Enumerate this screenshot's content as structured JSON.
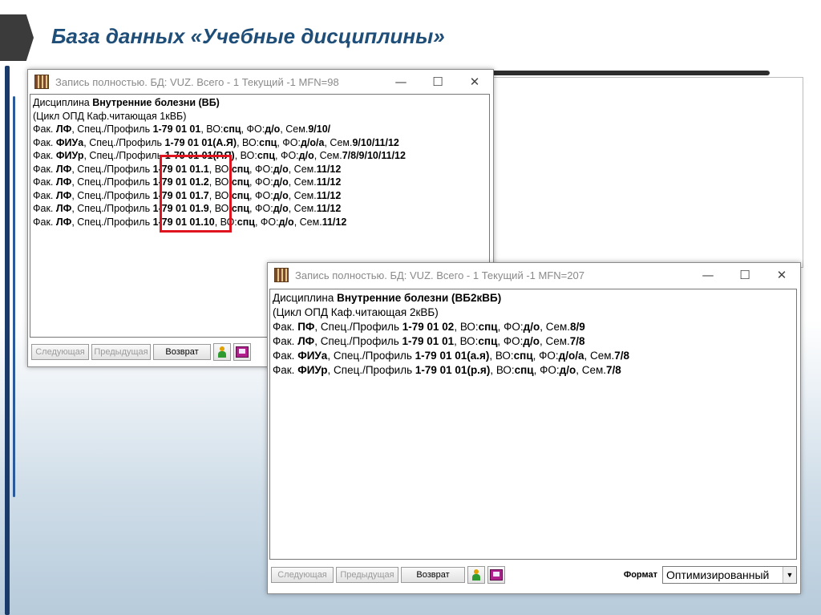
{
  "slide": {
    "title": "База данных «Учебные дисциплины»"
  },
  "window1": {
    "title": "Запись полностью.  БД: VUZ. Всего - 1  Текущий -1   MFN=98",
    "lines": [
      [
        [
          "Дисциплина ",
          false
        ],
        [
          "Внутренние болезни (ВБ)",
          true
        ]
      ],
      [
        [
          "(Цикл ОПД  Каф.читающая 1кВБ)",
          false
        ]
      ],
      [
        [
          " Фак. ",
          false
        ],
        [
          "ЛФ",
          true
        ],
        [
          ", Спец./Профиль ",
          false
        ],
        [
          "1-79 01 01",
          true
        ],
        [
          ", ВО:",
          false
        ],
        [
          "спц",
          true
        ],
        [
          ", ФО:",
          false
        ],
        [
          "д/о",
          true
        ],
        [
          ",  Сем.",
          false
        ],
        [
          "9/10/",
          true
        ]
      ],
      [
        [
          " Фак. ",
          false
        ],
        [
          "ФИУа",
          true
        ],
        [
          ", Спец./Профиль ",
          false
        ],
        [
          "1-79 01 01(А.Я)",
          true
        ],
        [
          ", ВО:",
          false
        ],
        [
          "спц",
          true
        ],
        [
          ", ФО:",
          false
        ],
        [
          "д/о/а",
          true
        ],
        [
          ",  Сем.",
          false
        ],
        [
          "9/10/11/12",
          true
        ]
      ],
      [
        [
          " Фак. ",
          false
        ],
        [
          "ФИУр",
          true
        ],
        [
          ", Спец./Профиль ",
          false
        ],
        [
          "1-79 01 01(Р.Я)",
          true
        ],
        [
          ", ВО:",
          false
        ],
        [
          "спц",
          true
        ],
        [
          ", ФО:",
          false
        ],
        [
          "д/о",
          true
        ],
        [
          ",  Сем.",
          false
        ],
        [
          "7/8/9/10/11/12",
          true
        ]
      ],
      [
        [
          " Фак. ",
          false
        ],
        [
          "ЛФ",
          true
        ],
        [
          ", Спец./Профиль ",
          false
        ],
        [
          "1-79 01 01.1",
          true
        ],
        [
          ", ВО:",
          false
        ],
        [
          "спц",
          true
        ],
        [
          ", ФО:",
          false
        ],
        [
          "д/о",
          true
        ],
        [
          ",  Сем.",
          false
        ],
        [
          "11/12",
          true
        ]
      ],
      [
        [
          " Фак. ",
          false
        ],
        [
          "ЛФ",
          true
        ],
        [
          ", Спец./Профиль ",
          false
        ],
        [
          "1-79 01 01.2",
          true
        ],
        [
          ", ВО:",
          false
        ],
        [
          "спц",
          true
        ],
        [
          ", ФО:",
          false
        ],
        [
          "д/о",
          true
        ],
        [
          ",  Сем.",
          false
        ],
        [
          "11/12",
          true
        ]
      ],
      [
        [
          " Фак. ",
          false
        ],
        [
          "ЛФ",
          true
        ],
        [
          ", Спец./Профиль ",
          false
        ],
        [
          "1-79 01 01.7",
          true
        ],
        [
          ", ВО:",
          false
        ],
        [
          "спц",
          true
        ],
        [
          ", ФО:",
          false
        ],
        [
          "д/о",
          true
        ],
        [
          ",  Сем.",
          false
        ],
        [
          "11/12",
          true
        ]
      ],
      [
        [
          " Фак. ",
          false
        ],
        [
          "ЛФ",
          true
        ],
        [
          ", Спец./Профиль ",
          false
        ],
        [
          "1-79 01 01.9",
          true
        ],
        [
          ", ВО:",
          false
        ],
        [
          "спц",
          true
        ],
        [
          ", ФО:",
          false
        ],
        [
          "д/о",
          true
        ],
        [
          ",  Сем.",
          false
        ],
        [
          "11/12",
          true
        ]
      ],
      [
        [
          " Фак. ",
          false
        ],
        [
          "ЛФ",
          true
        ],
        [
          ", Спец./Профиль ",
          false
        ],
        [
          "1-79 01 01.10",
          true
        ],
        [
          ", ВО:",
          false
        ],
        [
          "спц",
          true
        ],
        [
          ", ФО:",
          false
        ],
        [
          "д/о",
          true
        ],
        [
          ",  Сем.",
          false
        ],
        [
          "11/12",
          true
        ]
      ]
    ],
    "buttons": {
      "next": "Следующая",
      "prev": "Предыдущая",
      "back": "Возврат"
    },
    "icons": [
      "person-icon",
      "card-icon"
    ]
  },
  "window2": {
    "title": "Запись полностью.  БД: VUZ. Всего - 1  Текущий -1   MFN=207",
    "lines": [
      [
        [
          "Дисциплина ",
          false
        ],
        [
          "Внутренние болезни (ВБ2кВБ)",
          true
        ]
      ],
      [
        [
          "(Цикл ОПД  Каф.читающая 2кВБ)",
          false
        ]
      ],
      [
        [
          " Фак. ",
          false
        ],
        [
          "ПФ",
          true
        ],
        [
          ", Спец./Профиль ",
          false
        ],
        [
          "1-79 01 02",
          true
        ],
        [
          ", ВО:",
          false
        ],
        [
          "спц",
          true
        ],
        [
          ", ФО:",
          false
        ],
        [
          "д/о",
          true
        ],
        [
          ",  Сем.",
          false
        ],
        [
          "8/9",
          true
        ]
      ],
      [
        [
          " Фак. ",
          false
        ],
        [
          "ЛФ",
          true
        ],
        [
          ", Спец./Профиль ",
          false
        ],
        [
          "1-79 01 01",
          true
        ],
        [
          ", ВО:",
          false
        ],
        [
          "спц",
          true
        ],
        [
          ", ФО:",
          false
        ],
        [
          "д/о",
          true
        ],
        [
          ",  Сем.",
          false
        ],
        [
          "7/8",
          true
        ]
      ],
      [
        [
          " Фак. ",
          false
        ],
        [
          "ФИУа",
          true
        ],
        [
          ", Спец./Профиль ",
          false
        ],
        [
          "1-79 01 01(а.я)",
          true
        ],
        [
          ", ВО:",
          false
        ],
        [
          "спц",
          true
        ],
        [
          ", ФО:",
          false
        ],
        [
          "д/о/а",
          true
        ],
        [
          ",  Сем.",
          false
        ],
        [
          "7/8",
          true
        ]
      ],
      [
        [
          " Фак. ",
          false
        ],
        [
          "ФИУр",
          true
        ],
        [
          ", Спец./Профиль ",
          false
        ],
        [
          "1-79 01 01(р.я)",
          true
        ],
        [
          ", ВО:",
          false
        ],
        [
          "спц",
          true
        ],
        [
          ", ФО:",
          false
        ],
        [
          "д/о",
          true
        ],
        [
          ",  Сем.",
          false
        ],
        [
          "7/8",
          true
        ]
      ]
    ],
    "buttons": {
      "next": "Следующая",
      "prev": "Предыдущая",
      "back": "Возврат"
    },
    "format": {
      "label": "Формат",
      "value": "Оптимизированный"
    }
  },
  "colors": {
    "title": "#1f4e79",
    "highlight_box": "#e0141e"
  }
}
